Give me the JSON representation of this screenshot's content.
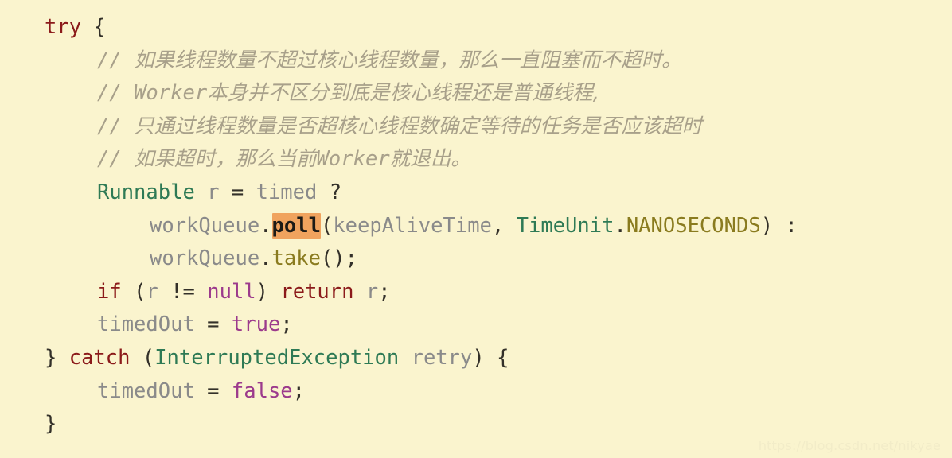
{
  "editor": {
    "background_color": "#faf4ce",
    "highlight_color": "#f0a35e",
    "language": "Java",
    "search_highlight_term": "poll"
  },
  "colors": {
    "keyword": "#8b1a1a",
    "type": "#2e7a55",
    "plain": "#8a8a8a",
    "punctuation": "#333029",
    "method": "#8a7b1f",
    "constant": "#8a7b1f",
    "literal": "#9c3a8c",
    "comment": "#a8a08a",
    "watermark": "#f2ecc8"
  },
  "code": {
    "lines": [
      {
        "indent": 0,
        "tokens": [
          {
            "t": "try",
            "c": "keyword"
          },
          {
            "t": " ",
            "c": "plain"
          },
          {
            "t": "{",
            "c": "punct"
          }
        ]
      },
      {
        "indent": 1,
        "tokens": [
          {
            "t": "// ",
            "c": "comment"
          },
          {
            "t": "如果线程数量不超过核心线程数量，那么一直阻塞而不超时。",
            "c": "comment-cn"
          }
        ]
      },
      {
        "indent": 1,
        "tokens": [
          {
            "t": "// ",
            "c": "comment"
          },
          {
            "t": "Worker",
            "c": "comment"
          },
          {
            "t": "本身并不区分到底是核心线程还是普通线程,",
            "c": "comment-cn"
          }
        ]
      },
      {
        "indent": 1,
        "tokens": [
          {
            "t": "// ",
            "c": "comment"
          },
          {
            "t": "只通过线程数量是否超核心线程数确定等待的任务是否应该超时",
            "c": "comment-cn"
          }
        ]
      },
      {
        "indent": 1,
        "tokens": [
          {
            "t": "// ",
            "c": "comment"
          },
          {
            "t": "如果超时，那么当前",
            "c": "comment-cn"
          },
          {
            "t": "Worker",
            "c": "comment"
          },
          {
            "t": "就退出。",
            "c": "comment-cn"
          }
        ]
      },
      {
        "indent": 1,
        "tokens": [
          {
            "t": "Runnable",
            "c": "type"
          },
          {
            "t": " r ",
            "c": "plain"
          },
          {
            "t": "=",
            "c": "punct"
          },
          {
            "t": " timed ",
            "c": "plain"
          },
          {
            "t": "?",
            "c": "punct"
          }
        ]
      },
      {
        "indent": 2,
        "tokens": [
          {
            "t": "workQueue",
            "c": "plain"
          },
          {
            "t": ".",
            "c": "punct"
          },
          {
            "t": "poll",
            "c": "highlight"
          },
          {
            "t": "(",
            "c": "punct"
          },
          {
            "t": "keepAliveTime",
            "c": "plain"
          },
          {
            "t": ",",
            "c": "punct"
          },
          {
            "t": " ",
            "c": "plain"
          },
          {
            "t": "TimeUnit",
            "c": "type"
          },
          {
            "t": ".",
            "c": "punct"
          },
          {
            "t": "NANOSECONDS",
            "c": "const"
          },
          {
            "t": ")",
            "c": "punct"
          },
          {
            "t": " ",
            "c": "plain"
          },
          {
            "t": ":",
            "c": "punct"
          }
        ]
      },
      {
        "indent": 2,
        "tokens": [
          {
            "t": "workQueue",
            "c": "plain"
          },
          {
            "t": ".",
            "c": "punct"
          },
          {
            "t": "take",
            "c": "method"
          },
          {
            "t": "();",
            "c": "punct"
          }
        ]
      },
      {
        "indent": 1,
        "tokens": [
          {
            "t": "if",
            "c": "keyword"
          },
          {
            "t": " ",
            "c": "plain"
          },
          {
            "t": "(",
            "c": "punct"
          },
          {
            "t": "r ",
            "c": "plain"
          },
          {
            "t": "!=",
            "c": "punct"
          },
          {
            "t": " ",
            "c": "plain"
          },
          {
            "t": "null",
            "c": "literal"
          },
          {
            "t": ")",
            "c": "punct"
          },
          {
            "t": " ",
            "c": "plain"
          },
          {
            "t": "return",
            "c": "keyword"
          },
          {
            "t": " r",
            "c": "plain"
          },
          {
            "t": ";",
            "c": "punct"
          }
        ]
      },
      {
        "indent": 1,
        "tokens": [
          {
            "t": "timedOut ",
            "c": "plain"
          },
          {
            "t": "=",
            "c": "punct"
          },
          {
            "t": " ",
            "c": "plain"
          },
          {
            "t": "true",
            "c": "literal"
          },
          {
            "t": ";",
            "c": "punct"
          }
        ]
      },
      {
        "indent": 0,
        "tokens": [
          {
            "t": "}",
            "c": "punct"
          },
          {
            "t": " ",
            "c": "plain"
          },
          {
            "t": "catch",
            "c": "keyword"
          },
          {
            "t": " ",
            "c": "plain"
          },
          {
            "t": "(",
            "c": "punct"
          },
          {
            "t": "InterruptedException",
            "c": "type"
          },
          {
            "t": " retry",
            "c": "plain"
          },
          {
            "t": ")",
            "c": "punct"
          },
          {
            "t": " ",
            "c": "plain"
          },
          {
            "t": "{",
            "c": "punct"
          }
        ]
      },
      {
        "indent": 1,
        "tokens": [
          {
            "t": "timedOut ",
            "c": "plain"
          },
          {
            "t": "=",
            "c": "punct"
          },
          {
            "t": " ",
            "c": "plain"
          },
          {
            "t": "false",
            "c": "literal"
          },
          {
            "t": ";",
            "c": "punct"
          }
        ]
      },
      {
        "indent": 0,
        "tokens": [
          {
            "t": "}",
            "c": "punct"
          }
        ]
      }
    ]
  },
  "watermark": {
    "text": "https://blog.csdn.net/nikyae"
  }
}
